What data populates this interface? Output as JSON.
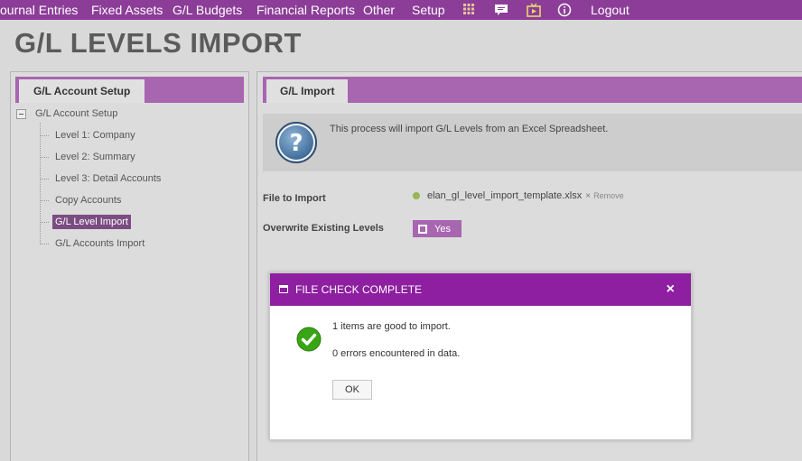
{
  "nav": {
    "items": [
      "ournal Entries",
      "Fixed Assets",
      "G/L Budgets",
      "Financial Reports",
      "Other",
      "Setup"
    ],
    "logout": "Logout",
    "icons": [
      "grid-icon",
      "chat-icon",
      "tv-icon",
      "info-icon"
    ],
    "bg_color": "#8c3d98"
  },
  "page": {
    "title": "G/L LEVELS IMPORT"
  },
  "left": {
    "tab_label": "G/L Account Setup",
    "tree_root": "G/L Account Setup",
    "tree_items": [
      "Level 1: Company",
      "Level 2: Summary",
      "Level 3: Detail Accounts",
      "Copy Accounts",
      "G/L Level Import",
      "G/L Accounts Import"
    ],
    "selected": "G/L Level Import"
  },
  "main": {
    "tab_label": "G/L Import",
    "info_text": "This process will import G/L Levels from an Excel Spreadsheet.",
    "file_label": "File to Import",
    "file_name": "elan_gl_level_import_template.xlsx",
    "remove_label": "Remove",
    "overwrite_label": "Overwrite Existing Levels",
    "overwrite_value": "Yes"
  },
  "modal": {
    "title": "FILE CHECK COMPLETE",
    "close": "×",
    "line1": "1 items are good to import.",
    "line2": "0 errors encountered in data.",
    "ok_label": "OK",
    "header_color": "#8e1fa0"
  }
}
